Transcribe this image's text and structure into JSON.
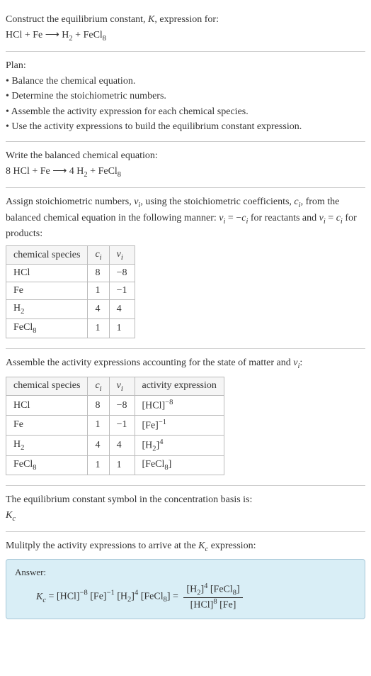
{
  "intro": {
    "line1_a": "Construct the equilibrium constant, ",
    "line1_k": "K",
    "line1_b": ", expression for:",
    "eq1": "HCl + Fe ⟶ H",
    "eq1_sub": "2",
    "eq1_tail": " + FeCl",
    "eq1_sub2": "8"
  },
  "plan": {
    "heading": "Plan:",
    "b1": "• Balance the chemical equation.",
    "b2": "• Determine the stoichiometric numbers.",
    "b3": "• Assemble the activity expression for each chemical species.",
    "b4": "• Use the activity expressions to build the equilibrium constant expression."
  },
  "balanced": {
    "heading": "Write the balanced chemical equation:",
    "eq_a": "8 HCl + Fe ⟶ 4 H",
    "eq_sub": "2",
    "eq_b": " + FeCl",
    "eq_sub2": "8"
  },
  "stoich": {
    "text_a": "Assign stoichiometric numbers, ",
    "nu": "ν",
    "text_b": ", using the stoichiometric coefficients, ",
    "ci": "c",
    "text_c": ", from the balanced chemical equation in the following manner: ",
    "rel1": " = −",
    "text_d": " for reactants and ",
    "rel2": " = ",
    "text_e": " for products:",
    "headers": {
      "species": "chemical species",
      "ci": "c",
      "nu": "ν"
    },
    "rows": [
      {
        "species": "HCl",
        "ci": "8",
        "nu": "−8"
      },
      {
        "species": "Fe",
        "ci": "1",
        "nu": "−1"
      },
      {
        "species_a": "H",
        "species_sub": "2",
        "ci": "4",
        "nu": "4"
      },
      {
        "species_a": "FeCl",
        "species_sub": "8",
        "ci": "1",
        "nu": "1"
      }
    ]
  },
  "activity": {
    "text_a": "Assemble the activity expressions accounting for the state of matter and ",
    "nu": "ν",
    "text_b": ":",
    "headers": {
      "species": "chemical species",
      "ci": "c",
      "nu": "ν",
      "act": "activity expression"
    },
    "rows": [
      {
        "species": "HCl",
        "ci": "8",
        "nu": "−8",
        "act_base": "[HCl]",
        "act_exp": "−8"
      },
      {
        "species": "Fe",
        "ci": "1",
        "nu": "−1",
        "act_base": "[Fe]",
        "act_exp": "−1"
      },
      {
        "species_a": "H",
        "species_sub": "2",
        "ci": "4",
        "nu": "4",
        "act_base_a": "[H",
        "act_base_sub": "2",
        "act_base_b": "]",
        "act_exp": "4"
      },
      {
        "species_a": "FeCl",
        "species_sub": "8",
        "ci": "1",
        "nu": "1",
        "act_base_a": "[FeCl",
        "act_base_sub": "8",
        "act_base_b": "]"
      }
    ]
  },
  "kc_symbol": {
    "heading": "The equilibrium constant symbol in the concentration basis is:",
    "sym_a": "K",
    "sym_sub": "c"
  },
  "multiply": {
    "text_a": "Mulitply the activity expressions to arrive at the ",
    "k": "K",
    "ksub": "c",
    "text_b": " expression:"
  },
  "answer": {
    "label": "Answer:",
    "Kc_a": "K",
    "Kc_sub": "c",
    "eq": " = ",
    "t1": "[HCl]",
    "e1": "−8",
    "t2": " [Fe]",
    "e2": "−1",
    "t3": " [H",
    "t3sub": "2",
    "t3b": "]",
    "e3": "4",
    "t4": " [FeCl",
    "t4sub": "8",
    "t4b": "] = ",
    "frac_top_a": "[H",
    "frac_top_sub": "2",
    "frac_top_b": "]",
    "frac_top_exp": "4",
    "frac_top_c": " [FeCl",
    "frac_top_sub2": "8",
    "frac_top_d": "]",
    "frac_bot_a": "[HCl]",
    "frac_bot_exp": "8",
    "frac_bot_b": " [Fe]"
  }
}
